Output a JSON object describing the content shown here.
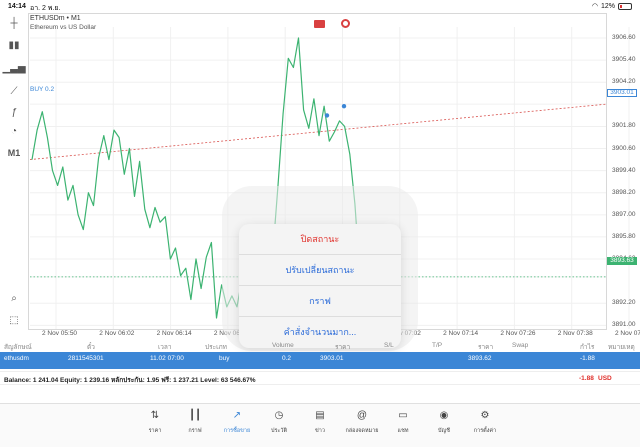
{
  "status_bar": {
    "time": "14:14",
    "date": "อา. 2 พ.ย.",
    "battery": "12%"
  },
  "chart": {
    "symbol": "ETHUSDm • M1",
    "description": "Ethereum vs US Dollar",
    "timeframe": "M1",
    "buy_line_label": "BUY 0.2",
    "buy_price_tag": "3903.01",
    "current_price_tag": "3893.63",
    "colors": {
      "line": "#3cb371",
      "buy_line": "#d9534f",
      "grid": "#f0f0f0",
      "price_tag": "#3cb371",
      "accent": "#3b86d6"
    },
    "y_ticks": [
      "3906.60",
      "3905.40",
      "3904.20",
      "3903.01",
      "3901.80",
      "3900.60",
      "3899.40",
      "3898.20",
      "3897.00",
      "3895.80",
      "3894.60",
      "3893.63",
      "3892.20",
      "3891.00"
    ],
    "x_ticks": [
      "2 Nov 05:50",
      "2 Nov 06:02",
      "2 Nov 06:14",
      "2 Nov 06:26",
      "2 Nov 06:38",
      "2 Nov 06:50",
      "2 Nov 07:02",
      "2 Nov 07:14",
      "2 Nov 07:26",
      "2 Nov 07:38",
      "2 Nov 07:50"
    ]
  },
  "chart_data": {
    "type": "line",
    "ylim": [
      3890.8,
      3907.2
    ],
    "series": [
      {
        "values": [
          3900.0,
          3901.6,
          3902.6,
          3901.2,
          3899.4,
          3898.6,
          3899.6,
          3897.8,
          3898.6,
          3897.0,
          3896.2,
          3898.2,
          3897.5,
          3900.1,
          3901.3,
          3900.0,
          3901.6,
          3901.2,
          3899.2,
          3900.6,
          3898.0,
          3899.9,
          3897.3,
          3896.3,
          3897.4,
          3896.6,
          3896.9,
          3894.6,
          3895.2,
          3893.7,
          3894.1,
          3892.4,
          3894.6,
          3893.0,
          3894.7,
          3895.5,
          3891.4,
          3893.2,
          3892.0,
          3892.6,
          3892.0,
          3893.6,
          3891.8,
          3893.1,
          3891.5,
          3892.2,
          3893.3,
          3895.0,
          3898.6,
          3902.5,
          3905.5,
          3905.0,
          3906.6,
          3902.7,
          3901.7,
          3903.3,
          3901.3,
          3902.9,
          3901.0,
          3901.5,
          3902.1,
          3901.8,
          3900.3,
          3897.6,
          3893.6
        ]
      }
    ],
    "buy_price": 3903.01,
    "current_price": 3893.63
  },
  "context_menu": {
    "items": [
      "ปิดสถานะ",
      "ปรับเปลี่ยนสถานะ",
      "กราฟ",
      "คำสั่งจำนวนมาก..."
    ]
  },
  "positions": {
    "headers": [
      "สัญลักษณ์",
      "ตั๋ว",
      "เวลา",
      "ประเภท",
      "Volume",
      "ราคา",
      "S/L",
      "T/P",
      "ราคา",
      "Swap",
      "กำไร",
      "หมายเหตุ"
    ],
    "row": {
      "symbol": "ethusdm",
      "ticket": "2811545301",
      "time": "11.02 07:00",
      "type": "buy",
      "volume": "0.2",
      "open_price": "3903.01",
      "current_price": "3893.62",
      "profit": "-1.88"
    }
  },
  "account": {
    "summary": "Balance: 1 241.04 Equity: 1 239.16 หลักประกัน: 1.95 ฟรี: 1 237.21 Level: 63 546.67%",
    "profit": "-1.88",
    "currency": "USD"
  },
  "tabs": [
    {
      "label": "ราคา",
      "icon": "quotes-icon"
    },
    {
      "label": "กราฟ",
      "icon": "candles-icon"
    },
    {
      "label": "การซื้อขาย",
      "icon": "trade-icon"
    },
    {
      "label": "ประวัติ",
      "icon": "history-icon"
    },
    {
      "label": "ข่าว",
      "icon": "news-icon"
    },
    {
      "label": "กล่องจดหมาย",
      "icon": "mailbox-icon"
    },
    {
      "label": "แชท",
      "icon": "chat-icon"
    },
    {
      "label": "บัญชี",
      "icon": "account-icon"
    },
    {
      "label": "การตั้งค่า",
      "icon": "settings-icon"
    }
  ]
}
